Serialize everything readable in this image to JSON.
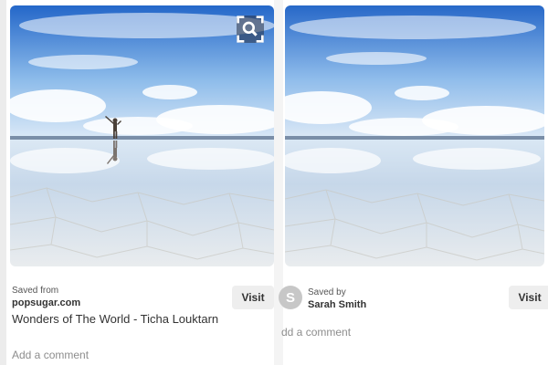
{
  "pins": [
    {
      "saved_label": "Saved from",
      "source": "popsugar.com",
      "title": "Wonders of The World - Ticha Louktarn",
      "visit_label": "Visit",
      "comment_placeholder": "Add a comment"
    },
    {
      "saved_label": "Saved by",
      "saver": "Sarah Smith",
      "avatar_initial": "S",
      "visit_label": "Visit",
      "comment_placeholder": "dd a comment"
    }
  ],
  "icons": {
    "zoom": "magnify-expand-icon"
  },
  "colors": {
    "sky_top": "#2a6fd0",
    "sky_bottom": "#cfe3f6",
    "salt_flat": "#e8ecef"
  }
}
